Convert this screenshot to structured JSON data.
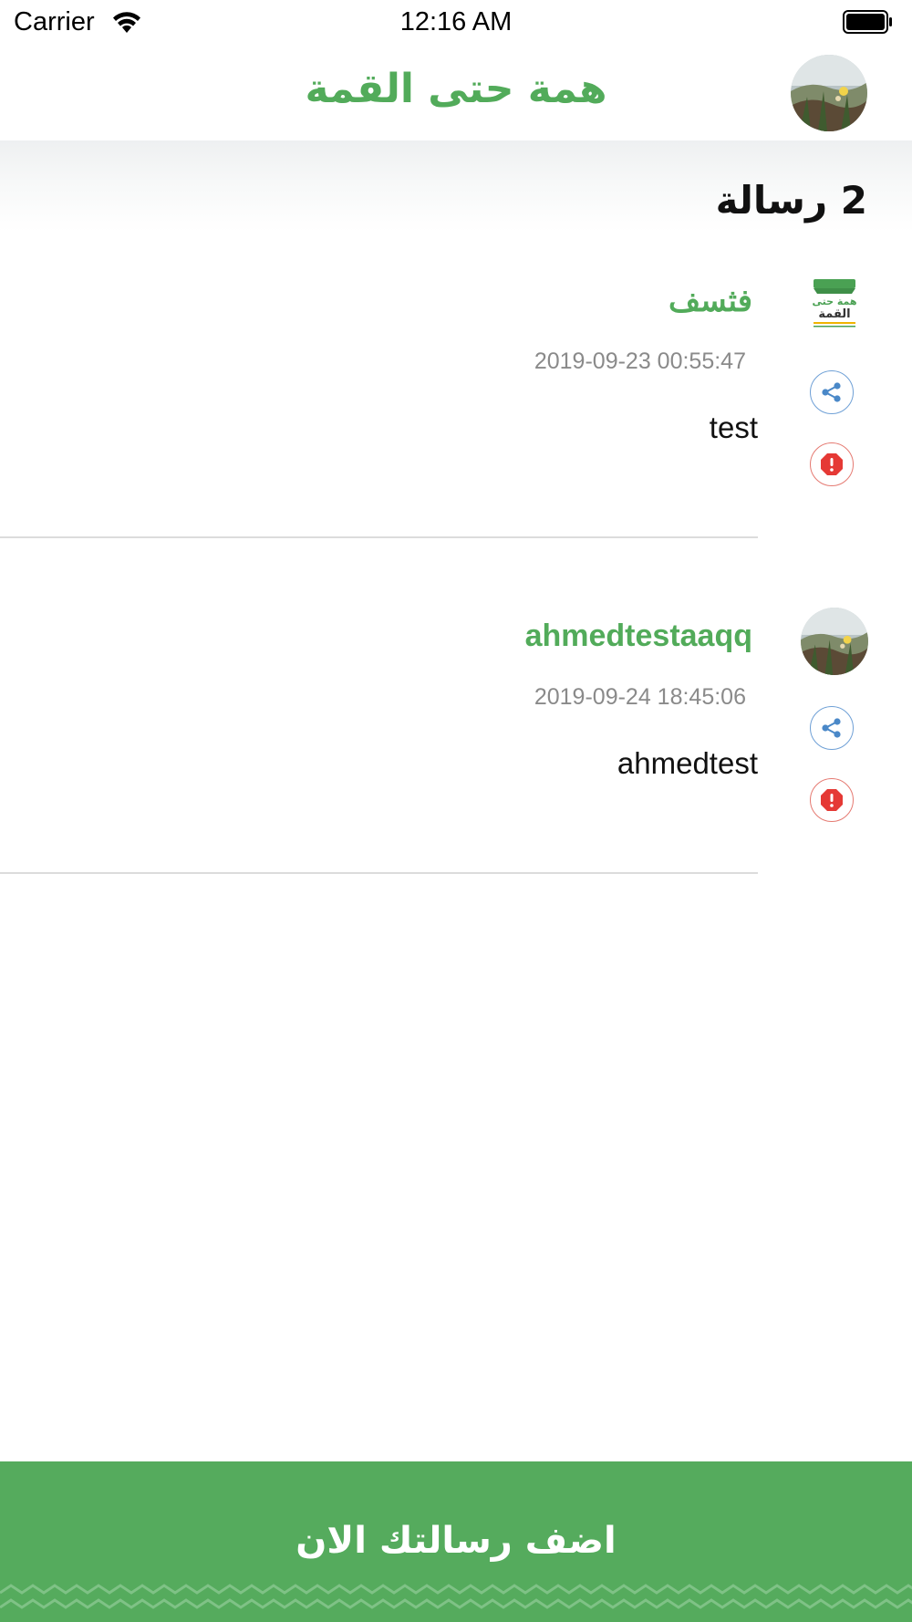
{
  "status_bar": {
    "carrier": "Carrier",
    "time": "12:16 AM"
  },
  "nav": {
    "title": "همة حتى القمة"
  },
  "messages_header": {
    "count_label": "2 رسالة"
  },
  "messages": [
    {
      "author": "فثسف",
      "date": "2019-09-23 00:55:47",
      "body": "test",
      "avatar": "app-logo"
    },
    {
      "author": "ahmedtestaaqq",
      "date": "2019-09-24 18:45:06",
      "body": "ahmedtest",
      "avatar": "user-photo"
    }
  ],
  "logo_text": {
    "line1": "همة حتى",
    "line2": "القمة"
  },
  "add_button": {
    "label": "اضف رسالتك الان"
  },
  "colors": {
    "brand_green": "#52ab5a",
    "share_blue": "#4a88c8",
    "report_red": "#e53935",
    "divider": "#dcdcdc"
  },
  "icons": {
    "share": "share-icon",
    "report": "report-icon",
    "wifi": "wifi-icon",
    "battery": "battery-icon"
  }
}
